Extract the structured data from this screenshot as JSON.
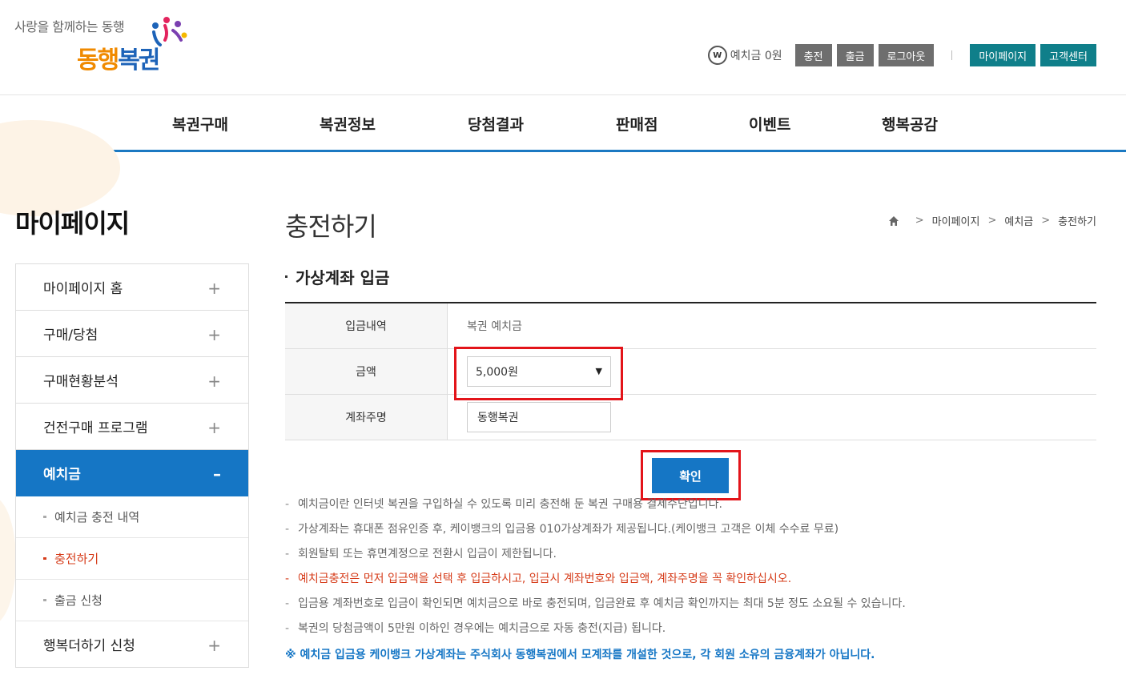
{
  "header": {
    "slogan": "사랑을 함께하는 동행",
    "brand_a": "동행",
    "brand_b": "복권",
    "deposit_icon": "W",
    "deposit_label": "예치금 0원",
    "buttons": {
      "charge": "충전",
      "withdraw": "출금",
      "logout": "로그아웃",
      "mypage": "마이페이지",
      "support": "고객센터"
    }
  },
  "gnb": [
    "복권구매",
    "복권정보",
    "당첨결과",
    "판매점",
    "이벤트",
    "행복공감"
  ],
  "side": {
    "title": "마이페이지",
    "menu": [
      {
        "label": "마이페이지 홈",
        "toggle": "+"
      },
      {
        "label": "구매/당첨",
        "toggle": "+"
      },
      {
        "label": "구매현황분석",
        "toggle": "+"
      },
      {
        "label": "건전구매 프로그램",
        "toggle": "+"
      },
      {
        "label": "예치금",
        "toggle": "–"
      }
    ],
    "submenu": [
      "예치금 충전 내역",
      "충전하기",
      "출금 신청"
    ],
    "menu_after": {
      "label": "행복더하기 신청",
      "toggle": "+"
    }
  },
  "content": {
    "page_title": "충전하기",
    "breadcrumb": [
      "마이페이지",
      "예치금",
      "충전하기"
    ],
    "section_title": "가상계좌 입금",
    "form": {
      "rows": [
        {
          "label": "입금내역",
          "value": "복권 예치금"
        },
        {
          "label": "금액",
          "value": "5,000원"
        },
        {
          "label": "계좌주명",
          "value": "동행복권"
        }
      ]
    },
    "confirm_label": "확인",
    "notes": [
      "예치금이란 인터넷 복권을 구입하실 수 있도록 미리 충전해 둔 복권 구매용 결제수단입니다.",
      "가상계좌는 휴대폰 점유인증 후, 케이뱅크의 입금용 010가상계좌가 제공됩니다.(케이뱅크 고객은 이체 수수료 무료)",
      "회원탈퇴 또는 휴면계정으로 전환시 입금이 제한됩니다.",
      "예치금충전은 먼저 입금액을 선택 후 입금하시고, 입금시 계좌번호와 입금액, 계좌주명을 꼭 확인하십시오.",
      "입금용 계좌번호로 입금이 확인되면 예치금으로 바로 충전되며, 입금완료 후 예치금 확인까지는 최대 5분 정도 소요될 수 있습니다.",
      "복권의 당첨금액이 5만원 이하인 경우에는 예치금으로 자동 충전(지급) 됩니다."
    ],
    "note_dash": "-",
    "footnote": "※ 예치금 입금용 케이뱅크 가상계좌는 주식회사 동행복권에서 모계좌를 개설한 것으로, 각 회원 소유의 금융계좌가 아닙니다."
  },
  "colors": {
    "accent": "#1576c5",
    "teal": "#0f7f8a",
    "alert": "#d63c1a",
    "highlight": "#e3141a"
  }
}
